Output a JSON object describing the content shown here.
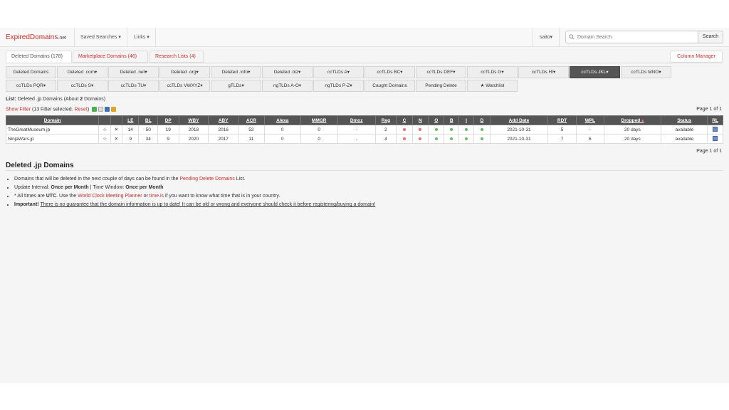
{
  "brand": {
    "name": "ExpiredDomains",
    "suffix": ".net"
  },
  "nav": {
    "saved_searches": "Saved Searches",
    "links": "Links",
    "user": "saito"
  },
  "search": {
    "placeholder": "Domain Search",
    "button": "Search"
  },
  "tabs": [
    {
      "label": "Deleted Domains (178)"
    },
    {
      "label": "Marketplace Domains (46)"
    },
    {
      "label": "Research Lists (4)"
    }
  ],
  "column_manager": "Column Manager",
  "filter_buttons_row1": [
    "Deleted Domains",
    "Deleted .com",
    "Deleted .net",
    "Deleted .org",
    "Deleted .info",
    "Deleted .biz",
    "ccTLDs A",
    "ccTLDs BC",
    "ccTLDs DEF",
    "ccTLDs G",
    "ccTLDs HI",
    "ccTLDs JKL",
    "ccTLDs MNO"
  ],
  "filter_buttons_row2": [
    "ccTLDs PQR",
    "ccTLDs S",
    "ccTLDs TU",
    "ccTLDs VWXYZ",
    "gTLDs",
    "ngTLDs A-O",
    "ngTLDs P-Z",
    "Caught Domains",
    "Pending Delete",
    "Watchlist"
  ],
  "list_info": {
    "label": "List:",
    "text": "Deleted .jp Domains (About",
    "count": "2",
    "suffix": "Domains)"
  },
  "filter_info": {
    "show_filter": "Show Filter",
    "selected": "(13 Filter selected.",
    "reset": "Reset",
    "close": ")"
  },
  "page_top": "Page 1 of 1",
  "page_bottom": "Page 1 of 1",
  "table": {
    "headers": [
      "Domain",
      "",
      "",
      "LE",
      "BL",
      "DP",
      "WBY",
      "ABY",
      "ACR",
      "Alexa",
      "MMGR",
      "Dmoz",
      "Reg",
      "C",
      "N",
      "O",
      "B",
      "I",
      "D",
      "Add Date",
      "RDT",
      "WPL",
      "Dropped",
      "Status",
      "RL"
    ],
    "rows": [
      {
        "domain": "TheGreatMuseum.jp",
        "le": "14",
        "bl": "50",
        "dp": "19",
        "wby": "2018",
        "aby": "2016",
        "acr": "52",
        "alexa": "0",
        "mmgr": "0",
        "dmoz": "-",
        "reg": "2",
        "flags": [
          "r",
          "r",
          "g",
          "g",
          "g",
          "g"
        ],
        "add_date": "2021-10-31",
        "rdt": "5",
        "wpl": "-",
        "dropped": "20 days",
        "status": "available"
      },
      {
        "domain": "NinjaWars.jp",
        "le": "9",
        "bl": "34",
        "dp": "9",
        "wby": "2020",
        "aby": "2017",
        "acr": "11",
        "alexa": "0",
        "mmgr": "0",
        "dmoz": "-",
        "reg": "4",
        "flags": [
          "r",
          "r",
          "g",
          "g",
          "g",
          "g"
        ],
        "add_date": "2021-10-31",
        "rdt": "7",
        "wpl": "6",
        "dropped": "20 days",
        "status": "available"
      }
    ]
  },
  "section": {
    "title": "Deleted .jp Domains",
    "note1_a": "Domains that will be deleted in the next couple of days can be found in the",
    "note1_link": "Pending Delete Domains",
    "note1_b": "List.",
    "note2_a": "Update Interval:",
    "note2_b": "Once per Month",
    "note2_c": "| Time Window:",
    "note2_d": "Once per Month",
    "note3_a": "* All times are",
    "note3_b": "UTC",
    "note3_c": ". Use the",
    "note3_link1": "World Clock Meeting Planner",
    "note3_d": "or",
    "note3_link2": "time.is",
    "note3_e": "if you want to know what time that is in your country.",
    "note4_a": "Important!",
    "note4_b": "There is no guarantee that the domain information is up to date! It can be old or wrong and everyone should check it before registering/buying a domain!"
  }
}
